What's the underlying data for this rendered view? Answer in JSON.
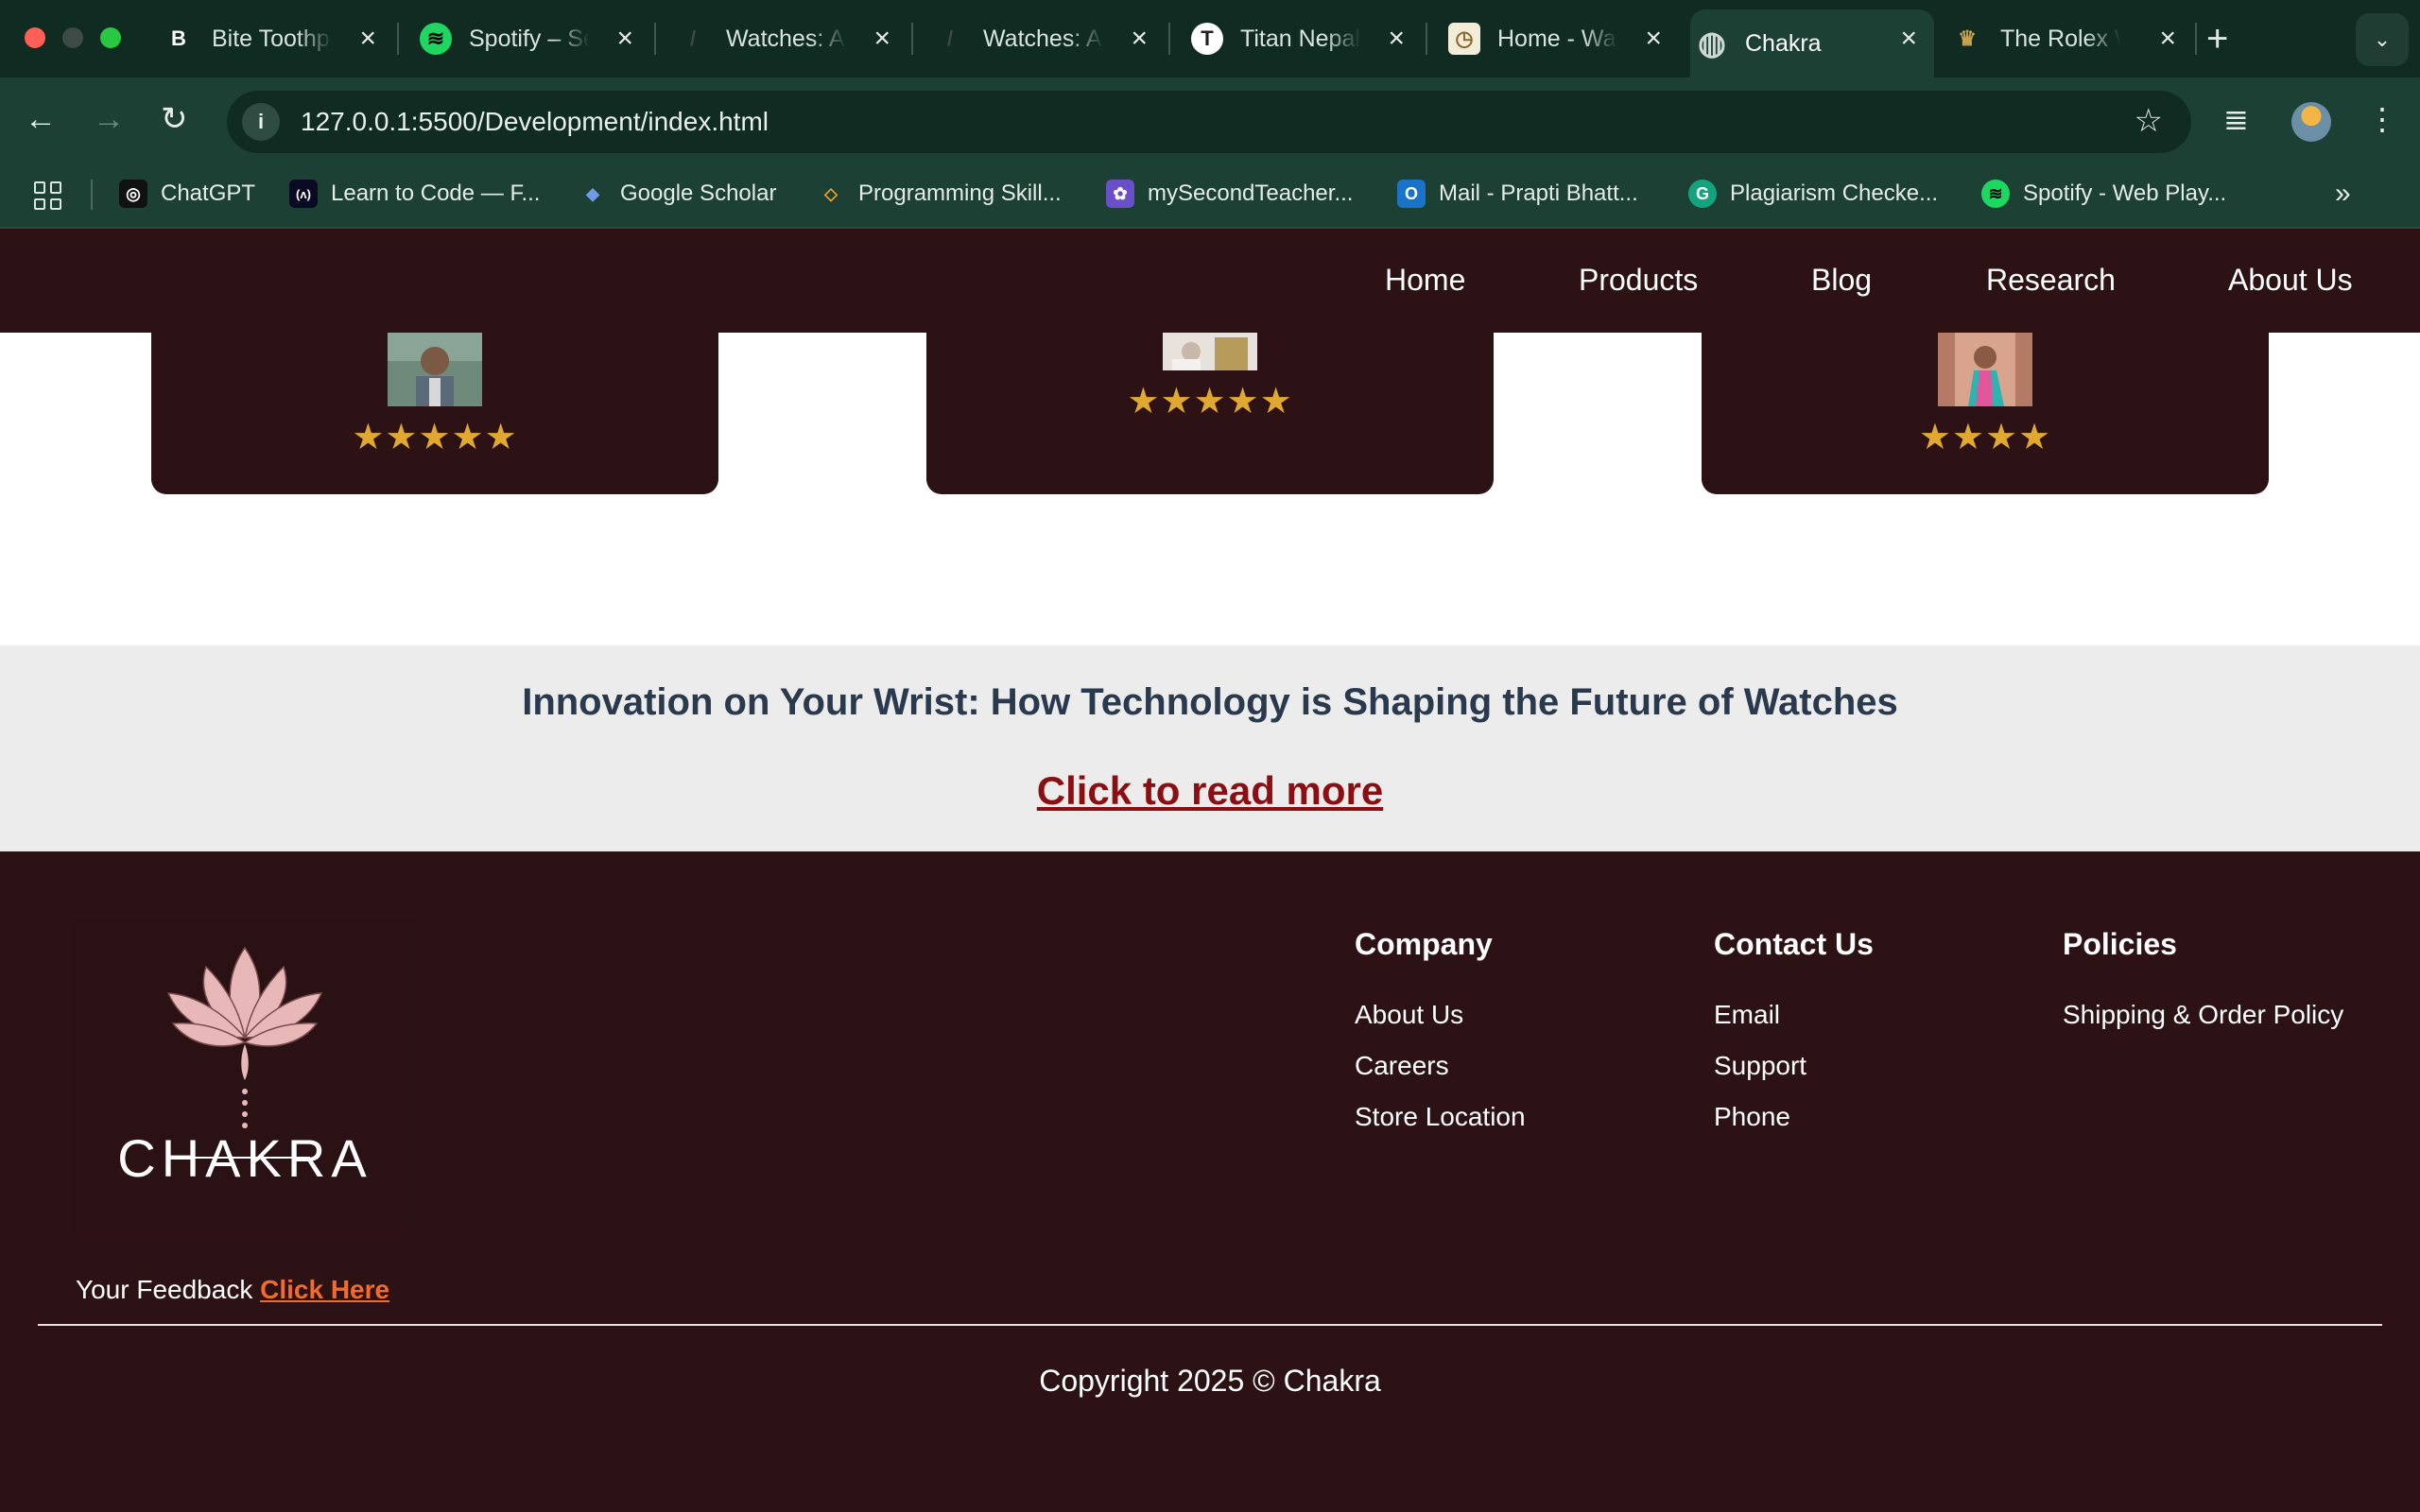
{
  "browser": {
    "tabs": [
      {
        "title": "Bite Toothpaste",
        "favicon": "B",
        "favicon_bg": "#0f2b22",
        "favicon_color": "#ffffff"
      },
      {
        "title": "Spotify – Search",
        "favicon": "≋",
        "favicon_bg": "#1ed760",
        "favicon_color": "#000000"
      },
      {
        "title": "Watches: A",
        "favicon": "/",
        "favicon_bg": "#0f2b22",
        "favicon_color": "#444444"
      },
      {
        "title": "Watches: A",
        "favicon": "/",
        "favicon_bg": "#0f2b22",
        "favicon_color": "#444444"
      },
      {
        "title": "Titan Nepal",
        "favicon": "T",
        "favicon_bg": "#ffffff",
        "favicon_color": "#222222"
      },
      {
        "title": "Home - Watch",
        "favicon": "◷",
        "favicon_bg": "#f3ecd8",
        "favicon_color": "#8a6a2a"
      },
      {
        "title": "Chakra",
        "favicon": "◍",
        "favicon_bg": "#1d4034",
        "favicon_color": "#cfd8d4",
        "active": true
      },
      {
        "title": "The Rolex W",
        "favicon": "♛",
        "favicon_bg": "#0f2b22",
        "favicon_color": "#c9a24a"
      }
    ],
    "url": "127.0.0.1:5500/Development/index.html",
    "bookmarks": [
      {
        "label": "ChatGPT",
        "icon": "◎",
        "bg": "#111111"
      },
      {
        "label": "Learn to Code — F...",
        "icon": "(ʌ)",
        "bg": "#0a0a23"
      },
      {
        "label": "Google Scholar",
        "icon": "◆",
        "bg": "#4a7fd8"
      },
      {
        "label": "Programming Skill...",
        "icon": "◇",
        "bg": "#222222"
      },
      {
        "label": "mySecondTeacher...",
        "icon": "✿",
        "bg": "#6a4fc8"
      },
      {
        "label": "Mail - Prapti Bhatt...",
        "icon": "O",
        "bg": "#1a73c8"
      },
      {
        "label": "Plagiarism Checke...",
        "icon": "G",
        "bg": "#15a37f"
      },
      {
        "label": "Spotify - Web Play...",
        "icon": "≋",
        "bg": "#1ed760"
      }
    ]
  },
  "nav": {
    "items": [
      "Home",
      "Products",
      "Blog",
      "Research",
      "About Us"
    ]
  },
  "testimonials": [
    {
      "rating": 5,
      "stars": "★★★★★"
    },
    {
      "rating": 5,
      "stars": "★★★★★"
    },
    {
      "rating": 4,
      "stars": "★★★★"
    }
  ],
  "blog": {
    "title": "Innovation on Your Wrist: How Technology is Shaping the Future of Watches",
    "link": "Click to read more"
  },
  "footer": {
    "logo_text": "CHAKRA",
    "company": {
      "heading": "Company",
      "links": [
        "About Us",
        "Careers",
        "Store Location"
      ]
    },
    "contact": {
      "heading": "Contact Us",
      "links": [
        "Email",
        "Support",
        "Phone"
      ]
    },
    "policies": {
      "heading": "Policies",
      "links": [
        "Shipping & Order Policy"
      ]
    },
    "feedback_label": "Your Feedback",
    "feedback_link": "Click Here",
    "copyright": "Copyright 2025 © Chakra"
  },
  "colors": {
    "maroon": "#2c1214",
    "link_red": "#8b0f12",
    "feedback_orange": "#f26b2a",
    "star_gold": "#e0a82e",
    "chrome_dark": "#0f2b22",
    "chrome_mid": "#1d4034"
  }
}
